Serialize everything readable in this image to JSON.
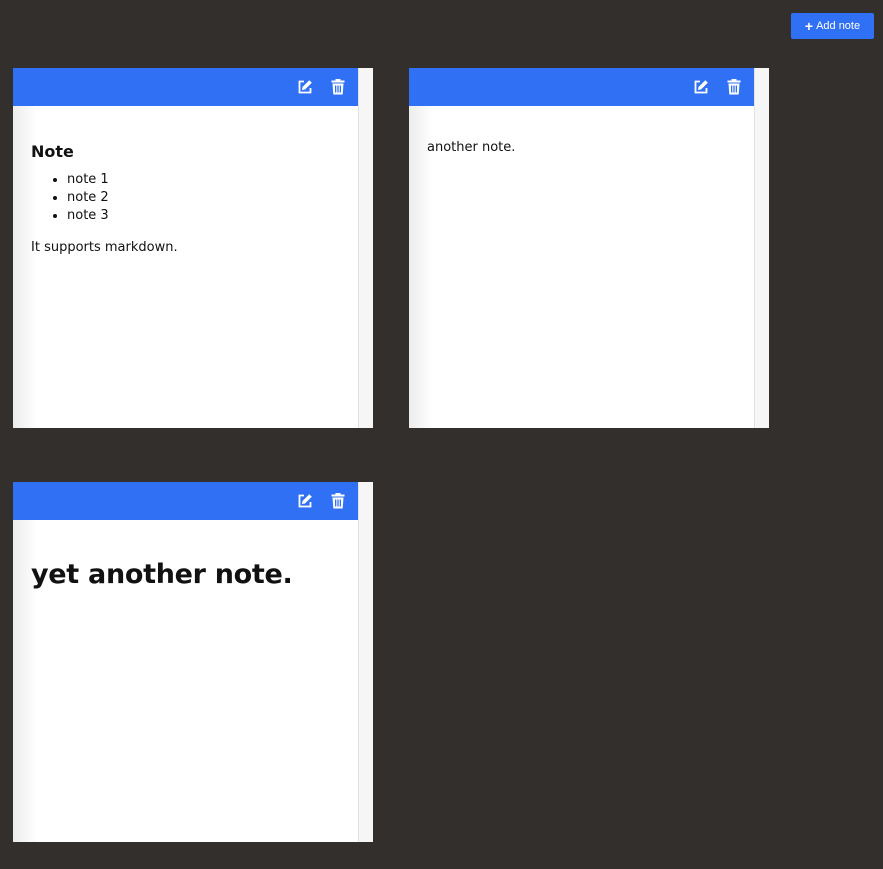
{
  "toolbar": {
    "add_note_label": "Add note",
    "add_icon": "plus-icon"
  },
  "colors": {
    "background": "#322f2c",
    "accent": "#3070f5",
    "card": "#ffffff"
  },
  "notes": [
    {
      "heading": "Note",
      "items": [
        "note 1",
        "note 2",
        "note 3"
      ],
      "text": "It supports markdown.",
      "icons": [
        "edit-icon",
        "trash-icon"
      ]
    },
    {
      "text": "another note.",
      "icons": [
        "edit-icon",
        "trash-icon"
      ]
    },
    {
      "big_heading": "yet another note.",
      "icons": [
        "edit-icon",
        "trash-icon"
      ]
    }
  ]
}
